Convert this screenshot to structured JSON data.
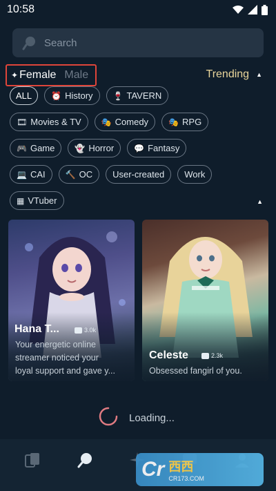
{
  "status": {
    "time": "10:58"
  },
  "search": {
    "placeholder": "Search"
  },
  "gender": {
    "female_label": "Female",
    "male_label": "Male"
  },
  "sort": {
    "label": "Trending"
  },
  "tags": {
    "row1": [
      {
        "label": "ALL",
        "icon": "",
        "active": true
      },
      {
        "label": "History",
        "icon": "⏰",
        "icon_name": "alarm-clock-icon"
      },
      {
        "label": "TAVERN",
        "icon": "🍷",
        "icon_name": "wine-glass-icon"
      }
    ],
    "row2": [
      {
        "label": "Movies & TV",
        "icon": "🎞",
        "icon_name": "film-icon"
      },
      {
        "label": "Comedy",
        "icon": "🎭",
        "icon_name": "masks-icon"
      },
      {
        "label": "RPG",
        "icon": "🎭",
        "icon_name": "masks-icon"
      }
    ],
    "row3": [
      {
        "label": "Game",
        "icon": "🎮",
        "icon_name": "gamepad-icon"
      },
      {
        "label": "Horror",
        "icon": "👻",
        "icon_name": "ghost-icon"
      },
      {
        "label": "Fantasy",
        "icon": "💬",
        "icon_name": "speech-bubble-icon"
      }
    ],
    "row4": [
      {
        "label": "CAI",
        "icon": "💻",
        "icon_name": "computer-icon"
      },
      {
        "label": "OC",
        "icon": "🔨",
        "icon_name": "hammer-icon"
      },
      {
        "label": "User-created",
        "icon": ""
      },
      {
        "label": "Work",
        "icon": ""
      }
    ],
    "row5": [
      {
        "label": "VTuber",
        "icon": "▦",
        "icon_name": "vtuber-icon"
      }
    ]
  },
  "cards": [
    {
      "name": "Hana T...",
      "chat_count": "3.0k",
      "description_lines": [
        "Your energetic online",
        "streamer noticed your",
        "loyal support and gave y..."
      ]
    },
    {
      "name": "Celeste",
      "chat_count": "2.3k",
      "description_lines": [
        "Obsessed fangirl of you."
      ]
    }
  ],
  "loading": {
    "label": "Loading..."
  },
  "watermark": {
    "logo": "Cr",
    "main": "西西",
    "sub": "CR173.COM"
  },
  "colors": {
    "background": "#0f1d2b",
    "accent_highlight": "#e0453a",
    "trending": "#e9d59b"
  }
}
